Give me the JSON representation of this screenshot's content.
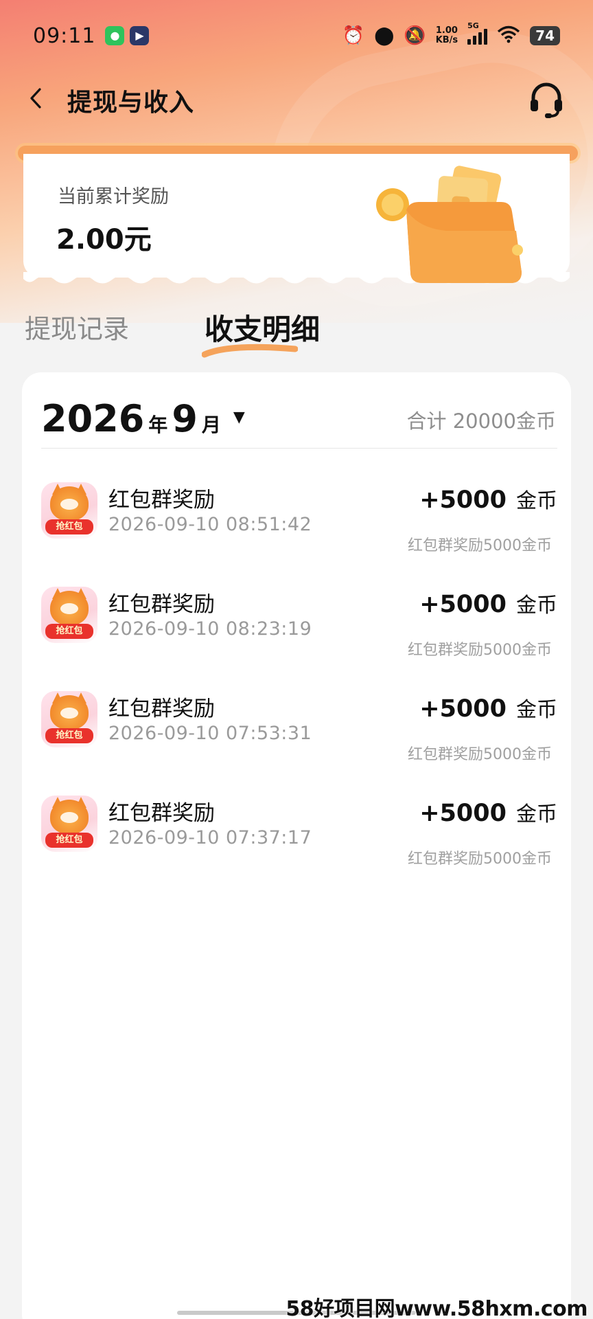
{
  "status_bar": {
    "time": "09:11",
    "net_speed_value": "1.00",
    "net_speed_unit": "KB/s",
    "network_type": "5G",
    "battery": "74"
  },
  "nav": {
    "title": "提现与收入"
  },
  "reward": {
    "label": "当前累计奖励",
    "value": "2.00元"
  },
  "tabs": {
    "withdraw": "提现记录",
    "detail": "收支明细"
  },
  "month_selector": {
    "year": "2026",
    "year_unit": "年",
    "month": "9",
    "month_unit": "月",
    "total": "合计 20000金币"
  },
  "records": [
    {
      "title": "红包群奖励",
      "time": "2026-09-10 08:51:42",
      "amount": "+5000",
      "unit": "金币",
      "desc": "红包群奖励5000金币",
      "icon_label": "抢红包"
    },
    {
      "title": "红包群奖励",
      "time": "2026-09-10 08:23:19",
      "amount": "+5000",
      "unit": "金币",
      "desc": "红包群奖励5000金币",
      "icon_label": "抢红包"
    },
    {
      "title": "红包群奖励",
      "time": "2026-09-10 07:53:31",
      "amount": "+5000",
      "unit": "金币",
      "desc": "红包群奖励5000金币",
      "icon_label": "抢红包"
    },
    {
      "title": "红包群奖励",
      "time": "2026-09-10 07:37:17",
      "amount": "+5000",
      "unit": "金币",
      "desc": "红包群奖励5000金币",
      "icon_label": "抢红包"
    }
  ],
  "watermark": "58好项目网www.58hxm.com",
  "colors": {
    "accent_orange": "#f6a15d",
    "text_primary": "#111111",
    "text_secondary": "#9a9a9a"
  }
}
